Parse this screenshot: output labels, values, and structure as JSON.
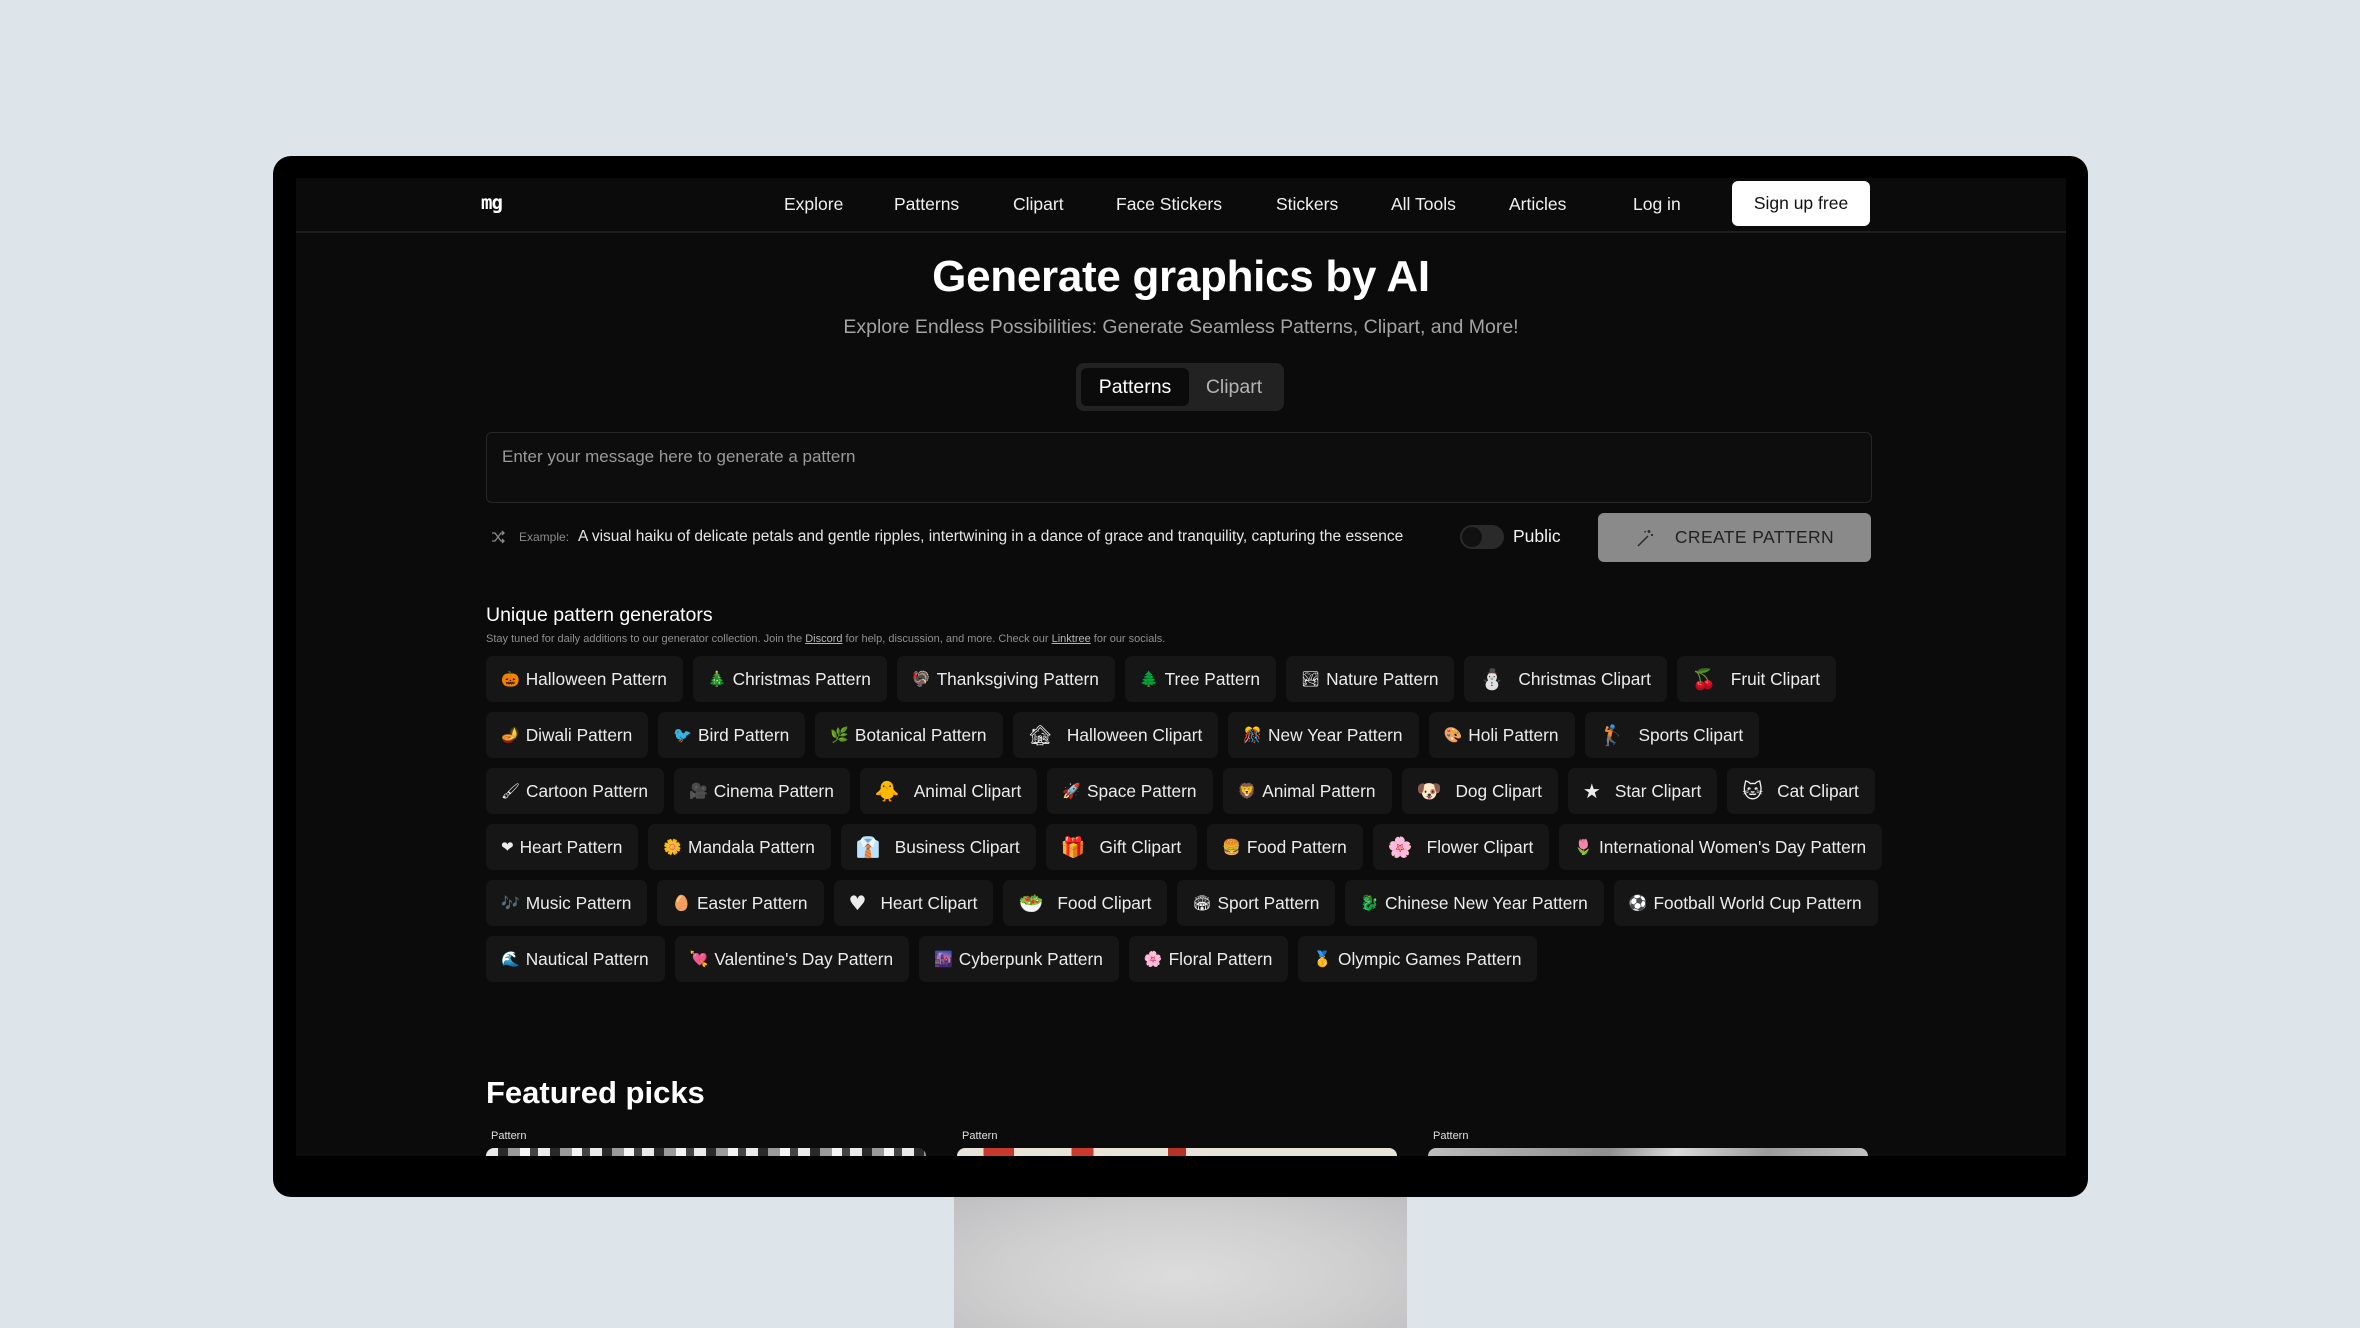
{
  "nav": {
    "logo": "mg",
    "links": [
      "Explore",
      "Patterns",
      "Clipart",
      "Face Stickers",
      "Stickers",
      "All Tools",
      "Articles"
    ],
    "login": "Log in",
    "signup": "Sign up free"
  },
  "hero": {
    "title": "Generate graphics by AI",
    "subtitle": "Explore Endless Possibilities: Generate Seamless Patterns, Clipart, and More!",
    "tabs": [
      {
        "label": "Patterns",
        "active": true
      },
      {
        "label": "Clipart",
        "active": false
      }
    ]
  },
  "prompt": {
    "placeholder": "Enter your message here to generate a pattern",
    "value": ""
  },
  "example": {
    "label": "Example:",
    "text": "A visual haiku of delicate petals and gentle ripples, intertwining in a dance of grace and tranquility, capturing the essence"
  },
  "visibility": {
    "label": "Public",
    "on": false
  },
  "create_button": "CREATE PATTERN",
  "generators": {
    "title": "Unique pattern generators",
    "desc_before": "Stay tuned for daily additions to our generator collection. Join the ",
    "discord": "Discord",
    "desc_middle": " for help, discussion, and more. Check our ",
    "linktree": "Linktree",
    "desc_after": " for our socials.",
    "items": [
      {
        "icon": "🎃",
        "label": "Halloween Pattern",
        "kind": "pattern"
      },
      {
        "icon": "🎄",
        "label": "Christmas Pattern",
        "kind": "pattern"
      },
      {
        "icon": "🦃",
        "label": "Thanksgiving Pattern",
        "kind": "pattern"
      },
      {
        "icon": "🌲",
        "label": "Tree Pattern",
        "kind": "pattern"
      },
      {
        "icon": "🏞",
        "label": "Nature Pattern",
        "kind": "pattern"
      },
      {
        "icon": "⛄",
        "label": "Christmas Clipart",
        "kind": "clipart"
      },
      {
        "icon": "🍒",
        "label": "Fruit Clipart",
        "kind": "clipart"
      },
      {
        "icon": "🪔",
        "label": "Diwali Pattern",
        "kind": "pattern"
      },
      {
        "icon": "🐦",
        "label": "Bird Pattern",
        "kind": "pattern"
      },
      {
        "icon": "🌿",
        "label": "Botanical Pattern",
        "kind": "pattern"
      },
      {
        "icon": "🏚",
        "label": "Halloween Clipart",
        "kind": "clipart"
      },
      {
        "icon": "🎊",
        "label": "New Year Pattern",
        "kind": "pattern"
      },
      {
        "icon": "🎨",
        "label": "Holi Pattern",
        "kind": "pattern"
      },
      {
        "icon": "🏌",
        "label": "Sports Clipart",
        "kind": "clipart"
      },
      {
        "icon": "🖌",
        "label": "Cartoon Pattern",
        "kind": "pattern"
      },
      {
        "icon": "🎥",
        "label": "Cinema Pattern",
        "kind": "pattern"
      },
      {
        "icon": "🐥",
        "label": "Animal Clipart",
        "kind": "clipart"
      },
      {
        "icon": "🚀",
        "label": "Space Pattern",
        "kind": "pattern"
      },
      {
        "icon": "🦁",
        "label": "Animal Pattern",
        "kind": "pattern"
      },
      {
        "icon": "🐶",
        "label": "Dog Clipart",
        "kind": "clipart"
      },
      {
        "icon": "★",
        "label": "Star Clipart",
        "kind": "clipart"
      },
      {
        "icon": "🐱",
        "label": "Cat Clipart",
        "kind": "clipart"
      },
      {
        "icon": "❤",
        "label": "Heart Pattern",
        "kind": "pattern"
      },
      {
        "icon": "🌼",
        "label": "Mandala Pattern",
        "kind": "pattern"
      },
      {
        "icon": "👔",
        "label": "Business Clipart",
        "kind": "clipart"
      },
      {
        "icon": "🎁",
        "label": "Gift Clipart",
        "kind": "clipart"
      },
      {
        "icon": "🍔",
        "label": "Food Pattern",
        "kind": "pattern"
      },
      {
        "icon": "🌸",
        "label": "Flower Clipart",
        "kind": "clipart"
      },
      {
        "icon": "🌷",
        "label": "International Women's Day Pattern",
        "kind": "pattern"
      },
      {
        "icon": "🎶",
        "label": "Music Pattern",
        "kind": "pattern"
      },
      {
        "icon": "🥚",
        "label": "Easter Pattern",
        "kind": "pattern"
      },
      {
        "icon": "♥",
        "label": "Heart Clipart",
        "kind": "clipart"
      },
      {
        "icon": "🥗",
        "label": "Food Clipart",
        "kind": "clipart"
      },
      {
        "icon": "🏟",
        "label": "Sport Pattern",
        "kind": "pattern"
      },
      {
        "icon": "🐉",
        "label": "Chinese New Year Pattern",
        "kind": "pattern"
      },
      {
        "icon": "⚽",
        "label": "Football World Cup Pattern",
        "kind": "pattern"
      },
      {
        "icon": "🌊",
        "label": "Nautical Pattern",
        "kind": "pattern"
      },
      {
        "icon": "💘",
        "label": "Valentine's Day Pattern",
        "kind": "pattern"
      },
      {
        "icon": "🌆",
        "label": "Cyberpunk Pattern",
        "kind": "pattern"
      },
      {
        "icon": "🌸",
        "label": "Floral Pattern",
        "kind": "pattern"
      },
      {
        "icon": "🥇",
        "label": "Olympic Games Pattern",
        "kind": "pattern"
      }
    ]
  },
  "featured": {
    "title": "Featured picks",
    "cards": [
      {
        "label": "Pattern"
      },
      {
        "label": "Pattern"
      },
      {
        "label": "Pattern"
      }
    ]
  }
}
